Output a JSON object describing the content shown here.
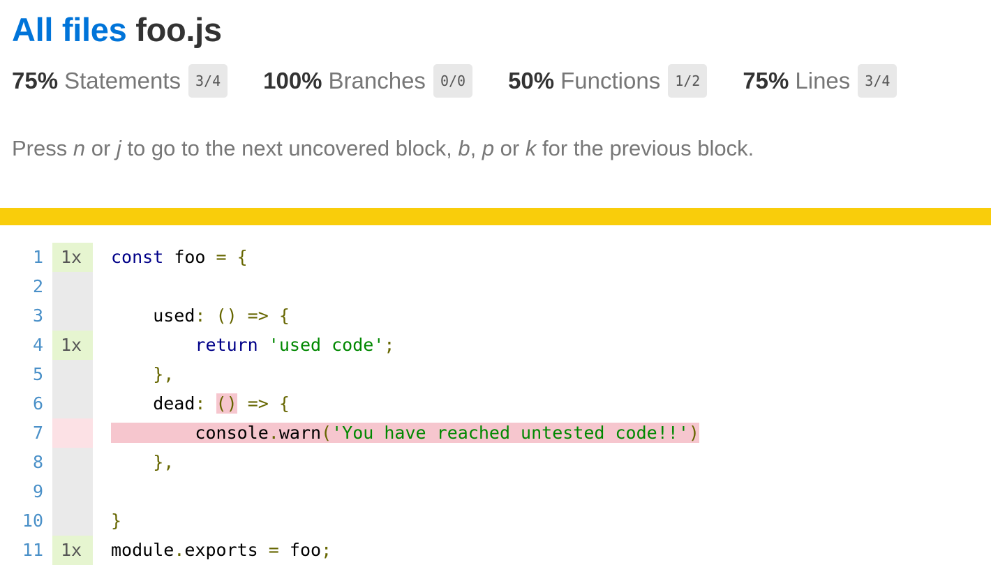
{
  "breadcrumb": {
    "link": "All files",
    "file": "foo.js"
  },
  "summary": [
    {
      "pct": "75%",
      "name": "Statements",
      "fraction": "3/4"
    },
    {
      "pct": "100%",
      "name": "Branches",
      "fraction": "0/0"
    },
    {
      "pct": "50%",
      "name": "Functions",
      "fraction": "1/2"
    },
    {
      "pct": "75%",
      "name": "Lines",
      "fraction": "3/4"
    }
  ],
  "hint": {
    "t1": "Press ",
    "k1": "n",
    "t2": " or ",
    "k2": "j",
    "t3": " to go to the next uncovered block, ",
    "k3": "b",
    "t4": ", ",
    "k4": "p",
    "t5": " or ",
    "k5": "k",
    "t6": " for the previous block."
  },
  "colors": {
    "link": "#0074d9",
    "status_bar": "#f9cd0b",
    "covered": "#e6f5d0",
    "uncovered": "#f6c6ce"
  },
  "code": {
    "line_numbers": [
      "1",
      "2",
      "3",
      "4",
      "5",
      "6",
      "7",
      "8",
      "9",
      "10",
      "11"
    ],
    "counts": [
      "1x",
      "",
      "",
      "1x",
      "",
      "",
      "",
      "",
      "",
      "",
      "1x"
    ],
    "tokens": {
      "l1_kw": "const",
      "l1_a": " foo ",
      "l1_b": "= {",
      "l3_a": "    used",
      "l3_b": ": () => {",
      "l4_a": "        ",
      "l4_kw": "return",
      "l4_b": " ",
      "l4_str": "'used code'",
      "l4_c": ";",
      "l5_b": "    },",
      "l6_a": "    dead",
      "l6_b": ": ",
      "l6_u": "()",
      "l6_c": " => {",
      "l7_a": "        console",
      "l7_b": ".",
      "l7_c": "warn",
      "l7_d": "(",
      "l7_str": "'You have reached untested code!!'",
      "l7_e": ")",
      "l8_b": "    },",
      "l10_b": "}",
      "l11_a": "module",
      "l11_b": ".",
      "l11_c": "exports ",
      "l11_d": "= ",
      "l11_e": "foo",
      "l11_f": ";"
    }
  }
}
